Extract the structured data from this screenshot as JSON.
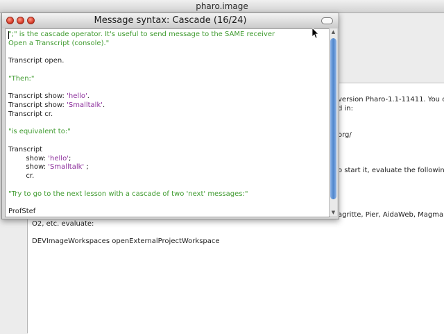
{
  "main_window": {
    "title": "pharo.image",
    "workspace_lines": [
      {
        "text": "version Pharo-1.1-11411. You c"
      },
      {
        "text": "d in:"
      },
      {
        "text": "org/"
      },
      {
        "text": "o start it, evaluate the following"
      },
      {
        "text": "agritte, Pier, AidaWeb, Magma, M"
      },
      {
        "text": "O2, etc. evaluate:"
      },
      {
        "text": "DEVImageWorkspaces openExternalProjectWorkspace"
      }
    ]
  },
  "lesson_window": {
    "title": "Message syntax: Cascade (16/24)",
    "code_lines": [
      {
        "text": "\";\" is the cascade operator. It's useful to send message to the SAME receiver",
        "kind": "comment"
      },
      {
        "text": "Open a Transcript (console).\"",
        "kind": "comment"
      },
      {
        "text": "",
        "kind": "default"
      },
      {
        "text": "Transcript open.",
        "kind": "default"
      },
      {
        "text": "",
        "kind": "default"
      },
      {
        "text": "\"Then:\"",
        "kind": "comment"
      },
      {
        "text": "",
        "kind": "default"
      },
      {
        "parts": [
          {
            "text": "Transcript show: ",
            "kind": "default"
          },
          {
            "text": "'hello'",
            "kind": "string"
          },
          {
            "text": ".",
            "kind": "default"
          }
        ]
      },
      {
        "parts": [
          {
            "text": "Transcript show: ",
            "kind": "default"
          },
          {
            "text": "'Smalltalk'",
            "kind": "string"
          },
          {
            "text": ".",
            "kind": "default"
          }
        ]
      },
      {
        "text": "Transcript cr.",
        "kind": "default"
      },
      {
        "text": "",
        "kind": "default"
      },
      {
        "text": "\"is equivalent to:\"",
        "kind": "comment"
      },
      {
        "text": "",
        "kind": "default"
      },
      {
        "text": "Transcript",
        "kind": "default"
      },
      {
        "parts": [
          {
            "text": "        show: ",
            "kind": "default"
          },
          {
            "text": "'hello'",
            "kind": "string"
          },
          {
            "text": ";",
            "kind": "default"
          }
        ]
      },
      {
        "parts": [
          {
            "text": "        show: ",
            "kind": "default"
          },
          {
            "text": "'Smalltalk'",
            "kind": "string"
          },
          {
            "text": " ;",
            "kind": "default"
          }
        ]
      },
      {
        "text": "        cr.",
        "kind": "default"
      },
      {
        "text": "",
        "kind": "default"
      },
      {
        "text": "\"Try to go to the next lesson with a cascade of two 'next' messages:\"",
        "kind": "comment"
      },
      {
        "text": "",
        "kind": "default"
      },
      {
        "text": "ProfStef",
        "kind": "default"
      }
    ]
  },
  "icons": {
    "close": "close-icon",
    "minimize": "minimize-icon",
    "expand": "expand-icon",
    "collapse": "collapse-icon",
    "cursor": "arrow-cursor-icon"
  },
  "colors": {
    "comment": "#3f9b2f",
    "string": "#8a2a9a",
    "default": "#242424",
    "scroll_thumb": "#4f86cc"
  }
}
